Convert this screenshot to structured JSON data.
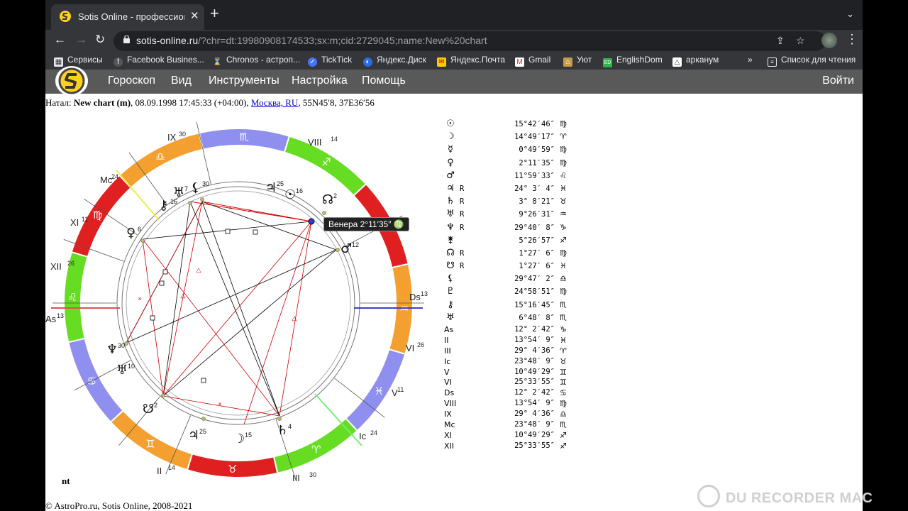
{
  "browser": {
    "tab_title": "Sotis Online - профессиональ",
    "url_host": "sotis-online.ru",
    "url_path": "/?chr=dt:19980908174533;sx:m;cid:2729045;name:New%20chart",
    "bookmarks": [
      "Сервисы",
      "Facebook Busines...",
      "Chronos - астроп...",
      "TickTick",
      "Яндекс.Диск",
      "Яндекс.Почта",
      "Gmail",
      "Уют",
      "EnglishDom",
      "арканум"
    ],
    "bookmarks_overflow": "»",
    "reading_list": "Список для чтения"
  },
  "site": {
    "menu": [
      "Гороскоп",
      "Вид",
      "Инструменты",
      "Настройка",
      "Помощь"
    ],
    "login": "Войти"
  },
  "natal": {
    "prefix": "Натал:",
    "chart_name": "New chart (m)",
    "datetime": ", 08.09.1998 17:45:33 (+04:00), ",
    "place": "Москва, RU",
    "coords": ", 55N45′8, 37E36′56"
  },
  "tooltip": "Венера 2°11′35″ ♍",
  "nt_label": "nt",
  "footer": "© AstroPro.ru, Sotis Online, 2008-2021",
  "watermark": "DU RECORDER MAC",
  "planets": [
    {
      "glyph": "☉",
      "retro": "",
      "value": "15°42′46″",
      "sign": "♍"
    },
    {
      "glyph": "☽",
      "retro": "",
      "value": "14°49′17″",
      "sign": "♈"
    },
    {
      "glyph": "☿",
      "retro": "",
      "value": "0°49′59″",
      "sign": "♍"
    },
    {
      "glyph": "♀",
      "retro": "",
      "value": "2°11′35″",
      "sign": "♍"
    },
    {
      "glyph": "♂",
      "retro": "",
      "value": "11°59′33″",
      "sign": "♌"
    },
    {
      "glyph": "♃",
      "retro": "R",
      "value": "24° 3′ 4″",
      "sign": "♓"
    },
    {
      "glyph": "♄",
      "retro": "R",
      "value": "3° 8′21″",
      "sign": "♉"
    },
    {
      "glyph": "♅",
      "retro": "R",
      "value": "9°26′31″",
      "sign": "♒"
    },
    {
      "glyph": "♆",
      "retro": "R",
      "value": "29°40′ 8″",
      "sign": "♑"
    },
    {
      "glyph": "⚵",
      "retro": "",
      "value": "5°26′57″",
      "sign": "♐"
    },
    {
      "glyph": "☊",
      "retro": "R",
      "value": "1°27′ 6″",
      "sign": "♍"
    },
    {
      "glyph": "☋",
      "retro": "R",
      "value": "1°27′ 6″",
      "sign": "♓"
    },
    {
      "glyph": "⚸",
      "retro": "",
      "value": "29°47′ 2″",
      "sign": "♎"
    },
    {
      "glyph": "♇",
      "retro": "",
      "value": "24°58′51″",
      "sign": "♍"
    },
    {
      "glyph": "⚷",
      "retro": "",
      "value": "15°16′45″",
      "sign": "♏"
    },
    {
      "glyph": "♅",
      "retro": "",
      "value": "6°48′ 8″",
      "sign": "♏"
    }
  ],
  "houses": [
    {
      "label": "As",
      "value": "12° 2′42″",
      "sign": "♑"
    },
    {
      "label": "II",
      "value": "13°54′ 9″",
      "sign": "♓"
    },
    {
      "label": "III",
      "value": "29° 4′36″",
      "sign": "♈"
    },
    {
      "label": "Ic",
      "value": "23°48′ 9″",
      "sign": "♉"
    },
    {
      "label": "V",
      "value": "10°49′29″",
      "sign": "♊"
    },
    {
      "label": "VI",
      "value": "25°33′55″",
      "sign": "♊"
    },
    {
      "label": "Ds",
      "value": "12° 2′42″",
      "sign": "♋"
    },
    {
      "label": "VIII",
      "value": "13°54′ 9″",
      "sign": "♍"
    },
    {
      "label": "IX",
      "value": "29° 4′36″",
      "sign": "♎"
    },
    {
      "label": "Mc",
      "value": "23°48′ 9″",
      "sign": "♏"
    },
    {
      "label": "XI",
      "value": "10°49′29″",
      "sign": "♐"
    },
    {
      "label": "XII",
      "value": "25°33′55″",
      "sign": "♐"
    }
  ],
  "wheel": {
    "house_labels": [
      {
        "label": "IX",
        "deg": "30"
      },
      {
        "label": "VIII",
        "deg": "14"
      },
      {
        "label": "Mc",
        "deg": "24"
      },
      {
        "label": "XI",
        "deg": "11"
      },
      {
        "label": "XII",
        "deg": "26"
      },
      {
        "label": "As",
        "deg": "13"
      },
      {
        "label": "Ds",
        "deg": "13"
      },
      {
        "label": "VI",
        "deg": "26"
      },
      {
        "label": "V",
        "deg": "11"
      },
      {
        "label": "Ic",
        "deg": "24"
      },
      {
        "label": "II",
        "deg": "14"
      },
      {
        "label": "III",
        "deg": "30"
      }
    ],
    "planet_labels": [
      {
        "glyph": "☉",
        "deg": "16"
      },
      {
        "glyph": "♃",
        "deg": "25"
      },
      {
        "glyph": "⚸",
        "deg": "30"
      },
      {
        "glyph": "♅",
        "deg": "7"
      },
      {
        "glyph": "⚷",
        "deg": "16"
      },
      {
        "glyph": "☊",
        "deg": "2"
      },
      {
        "glyph": "♀",
        "deg": "6"
      },
      {
        "glyph": "♂",
        "deg": "12"
      },
      {
        "glyph": "♆",
        "deg": "30"
      },
      {
        "glyph": "♅",
        "deg": "10"
      },
      {
        "glyph": "☋",
        "deg": "2"
      },
      {
        "glyph": "♃",
        "deg": "25"
      },
      {
        "glyph": "☽",
        "deg": "15"
      },
      {
        "glyph": "♄",
        "deg": "4"
      }
    ],
    "signs": [
      "♎",
      "♍",
      "♌",
      "♋",
      "♊",
      "♉",
      "♈",
      "♓",
      "♒",
      "♑",
      "♐",
      "♏"
    ]
  }
}
